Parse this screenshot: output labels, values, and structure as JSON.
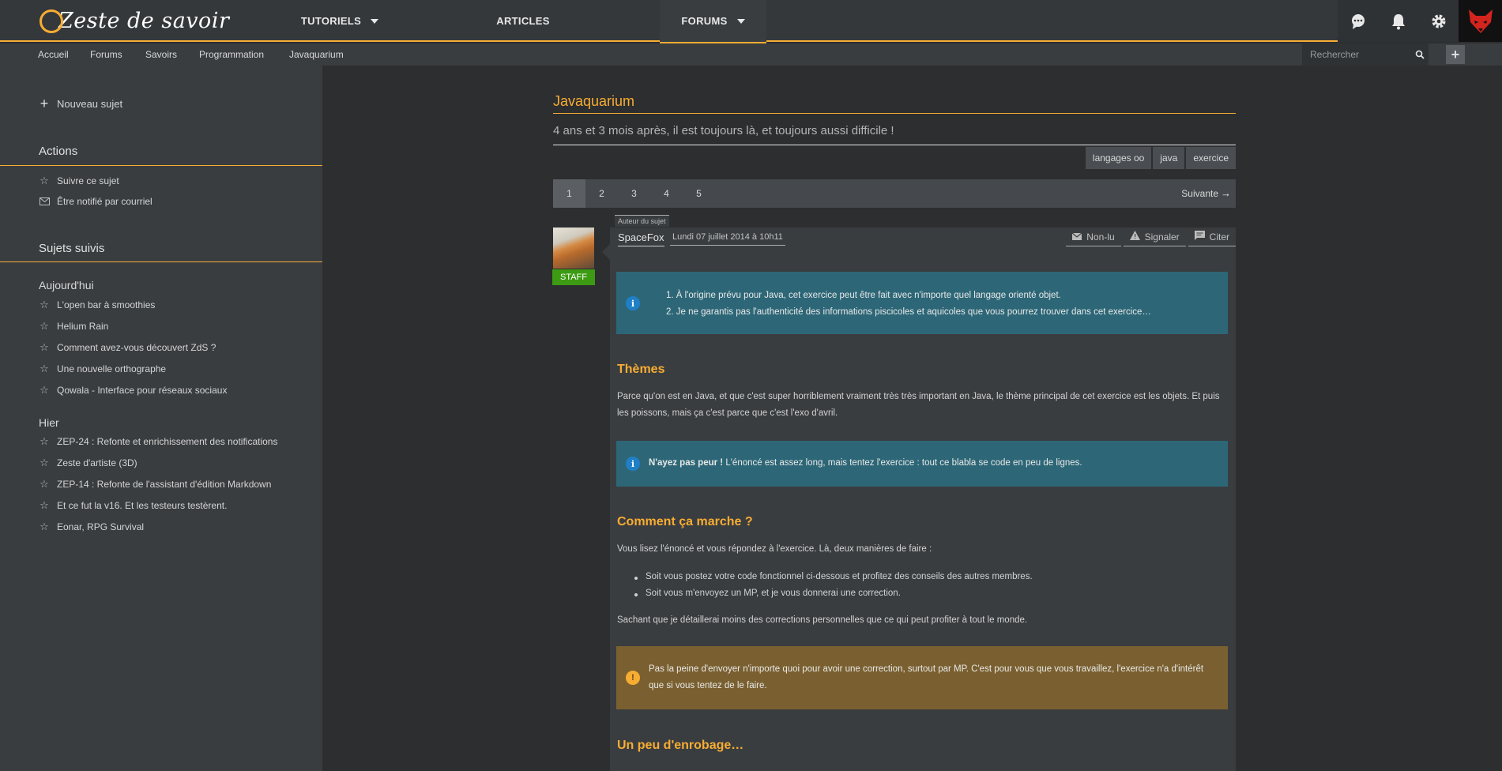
{
  "header": {
    "logo_text": "Zeste de savoir",
    "nav": [
      {
        "label": "TUTORIELS"
      },
      {
        "label": "ARTICLES"
      },
      {
        "label": "FORUMS"
      }
    ]
  },
  "breadcrumbs": [
    "Accueil",
    "Forums",
    "Savoirs",
    "Programmation",
    "Javaquarium"
  ],
  "search": {
    "placeholder": "Rechercher"
  },
  "sidebar": {
    "new_topic": "Nouveau sujet",
    "actions_title": "Actions",
    "actions": [
      "Suivre ce sujet",
      "Être notifié par courriel"
    ],
    "followed_title": "Sujets suivis",
    "today_label": "Aujourd'hui",
    "today": [
      "L'open bar à smoothies",
      "Helium Rain",
      "Comment avez-vous découvert ZdS ?",
      "Une nouvelle orthographe",
      "Qowala - Interface pour réseaux sociaux"
    ],
    "yesterday_label": "Hier",
    "yesterday": [
      "ZEP-24 : Refonte et enrichissement des notifications",
      "Zeste d'artiste (3D)",
      "ZEP-14 : Refonte de l'assistant d'édition Markdown",
      "Et ce fut la v16. Et les testeurs testèrent.",
      "Eonar, RPG Survival"
    ]
  },
  "topic": {
    "title": "Javaquarium",
    "subtitle": "4 ans et 3 mois après, il est toujours là, et toujours aussi difficile !",
    "tags": [
      "langages oo",
      "java",
      "exercice"
    ]
  },
  "pager": {
    "pages": [
      "1",
      "2",
      "3",
      "4",
      "5"
    ],
    "next": "Suivante"
  },
  "post": {
    "author_tag": "Auteur du sujet",
    "author": "SpaceFox",
    "badge": "STAFF",
    "date": "Lundi 07 juillet 2014 à 10h11",
    "actions": [
      "Non-lu",
      "Signaler",
      "Citer"
    ],
    "info_list": [
      "À l'origine prévu pour Java, cet exercice peut être fait avec n'importe quel langage orienté objet.",
      "Je ne garantis pas l'authenticité des informations piscicoles et aquicoles que vous pourrez trouver dans cet exercice…"
    ],
    "h_themes": "Thèmes",
    "p_themes": "Parce qu'on est en Java, et que c'est super horriblement vraiment très très important en Java, le thème principal de cet exercice est les objets. Et puis les poissons, mais ça c'est parce que c'est l'exo d'avril.",
    "info2_bold": "N'ayez pas peur !",
    "info2_text": " L'énoncé est assez long, mais tentez l'exercice : tout ce blabla se code en peu de lignes.",
    "h_how": "Comment ça marche ?",
    "p_how": "Vous lisez l'énoncé et vous répondez à l'exercice. Là, deux manières de faire :",
    "bullets": [
      "Soit vous postez votre code fonctionnel ci-dessous et profitez des conseils des autres membres.",
      "Soit vous m'envoyez un MP, et je vous donnerai une correction."
    ],
    "p_after": "Sachant que je détaillerai moins des corrections personnelles que ce qui peut profiter à tout le monde.",
    "warn_text": "Pas la peine d'envoyer n'importe quoi pour avoir une correction, surtout par MP. C'est pour vous que vous travaillez, l'exercice n'a d'intérêt que si vous tentez de le faire.",
    "h_wrap": "Un peu d'enrobage…"
  }
}
